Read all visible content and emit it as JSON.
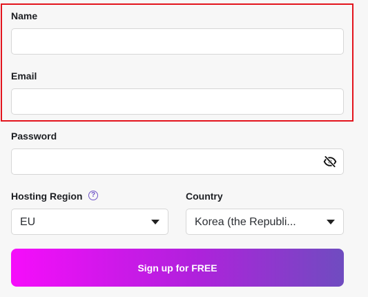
{
  "form": {
    "name": {
      "label": "Name",
      "value": "",
      "placeholder": ""
    },
    "email": {
      "label": "Email",
      "value": "",
      "placeholder": ""
    },
    "password": {
      "label": "Password",
      "value": "",
      "placeholder": "",
      "toggle_icon": "eye-slash-icon"
    },
    "hosting_region": {
      "label": "Hosting Region",
      "help_icon": "question-circle-icon",
      "help_glyph": "?",
      "selected": "EU"
    },
    "country": {
      "label": "Country",
      "selected": "Korea (the Republi..."
    },
    "submit_label": "Sign up for FREE"
  },
  "colors": {
    "highlight_border": "#e3131c",
    "accent_purple": "#6f55c7",
    "button_gradient_start": "#f60dfb",
    "button_gradient_mid": "#b021dc",
    "button_gradient_end": "#6f4cc0",
    "background": "#f7f7f7"
  }
}
